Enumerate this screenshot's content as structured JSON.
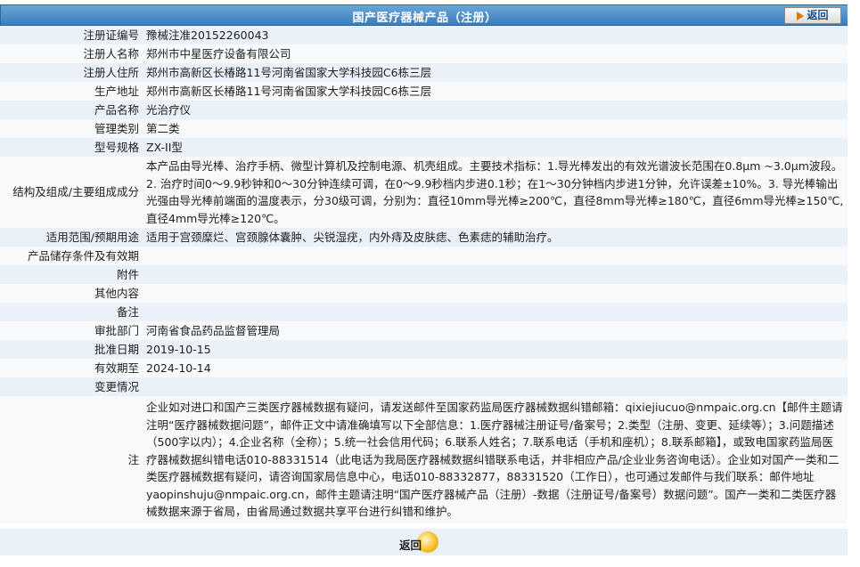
{
  "header": {
    "title": "国产医疗器械产品（注册）",
    "back_label": "返回"
  },
  "rows": [
    {
      "label": "注册证编号",
      "value": "豫械注准20152260043"
    },
    {
      "label": "注册人名称",
      "value": "郑州市中星医疗设备有限公司"
    },
    {
      "label": "注册人住所",
      "value": "郑州市高新区长椿路11号河南省国家大学科技园C6栋三层"
    },
    {
      "label": "生产地址",
      "value": "郑州市高新区长椿路11号河南省国家大学科技园C6栋三层"
    },
    {
      "label": "产品名称",
      "value": "光治疗仪"
    },
    {
      "label": "管理类别",
      "value": "第二类"
    },
    {
      "label": "型号规格",
      "value": "ZX-II型"
    },
    {
      "label": "结构及组成/主要组成成分",
      "value": "本产品由导光棒、治疗手柄、微型计算机及控制电源、机壳组成。主要技术指标：1.导光棒发出的有效光谱波长范围在0.8μm ~3.0μm波段。2. 治疗时间0～9.9秒钟和0～30分钟连续可调，在0～9.9秒档内步进0.1秒；在1～30分钟档内步进1分钟，允许误差±10%。3. 导光棒输出光强由导光棒前端面的温度表示，分30级可调，分别为：直径10mm导光棒≥200℃，直径8mm导光棒≥180℃，直径6mm导光棒≥150℃,直径4mm导光棒≥120℃。"
    },
    {
      "label": "适用范围/预期用途",
      "value": "适用于宫颈糜烂、宫颈腺体囊肿、尖锐湿疣，内外痔及皮肤痣、色素痣的辅助治疗。"
    },
    {
      "label": "产品储存条件及有效期",
      "value": ""
    },
    {
      "label": "附件",
      "value": ""
    },
    {
      "label": "其他内容",
      "value": ""
    },
    {
      "label": "备注",
      "value": ""
    },
    {
      "label": "审批部门",
      "value": "河南省食品药品监督管理局"
    },
    {
      "label": "批准日期",
      "value": "2019-10-15"
    },
    {
      "label": "有效期至",
      "value": "2024-10-14"
    },
    {
      "label": "变更情况",
      "value": ""
    }
  ],
  "note": {
    "label": "注",
    "text": "企业如对进口和国产三类医疗器械数据有疑问，请发送邮件至国家药监局医疗器械数据纠错邮箱：qixiejiucuo@nmpaic.org.cn【邮件主题请注明“医疗器械数据问题”，邮件正文中请准确填写以下全部信息：1.医疗器械注册证号/备案号；2.类型（注册、变更、延续等）；3.问题描述（500字以内）；4.企业名称（全称）；5.统一社会信用代码；6.联系人姓名；7.联系电话（手机和座机）；8.联系邮箱】，或致电国家药监局医疗器械数据纠错电话010-88331514（此电话为我局医疗器械数据纠错联系电话，并非相应产品/企业业务咨询电话）。企业如对国产一类和二类医疗器械数据有疑问，请咨询国家局信息中心，电话010-88332877，88331520（工作日），也可通过发邮件与我们联系：邮件地址yaopinshuju@nmpaic.org.cn，邮件主题请注明“国产医疗器械产品（注册）-数据（注册证号/备案号）数据问题”。国产一类和二类医疗器械数据来源于省局，由省局通过数据共享平台进行纠错和维护。"
  },
  "footer": {
    "back_label": "返回"
  }
}
